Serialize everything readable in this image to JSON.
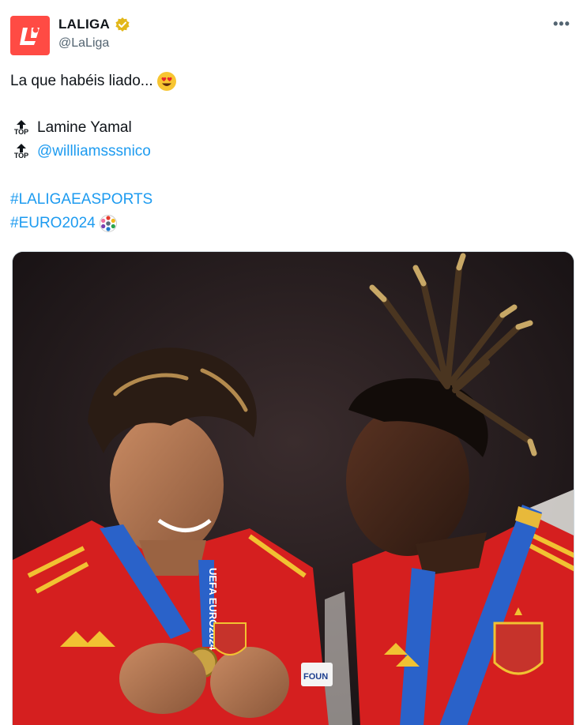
{
  "author": {
    "display_name": "LALIGA",
    "handle": "@LaLiga",
    "verified": true,
    "avatar_color": "#ff4b44",
    "verified_color": "#e2b719"
  },
  "more_label": "•••",
  "body": {
    "line1": "La que habéis liado...",
    "line1_emoji": "smiling-face-heart-eyes-icon",
    "top_label": "TOP",
    "mention_plain": "Lamine Yamal",
    "mention_link": "@willliamsssnico",
    "hashtag1": "#LALIGAEASPORTS",
    "hashtag2": "#EURO2024",
    "hashtag2_emoji": "euro2024-logo-icon"
  },
  "media": {
    "alt": "Photo of two Spain players wearing UEFA EURO 2024 medals",
    "lanyard_text": "UEFA EURO2024",
    "badge_text": "FOUN"
  },
  "colors": {
    "link": "#1d9bf0",
    "text": "#0f1419",
    "muted": "#536471",
    "jersey_red": "#d51f1f",
    "jersey_yellow": "#f1c232",
    "lanyard_blue": "#2a62c9"
  }
}
